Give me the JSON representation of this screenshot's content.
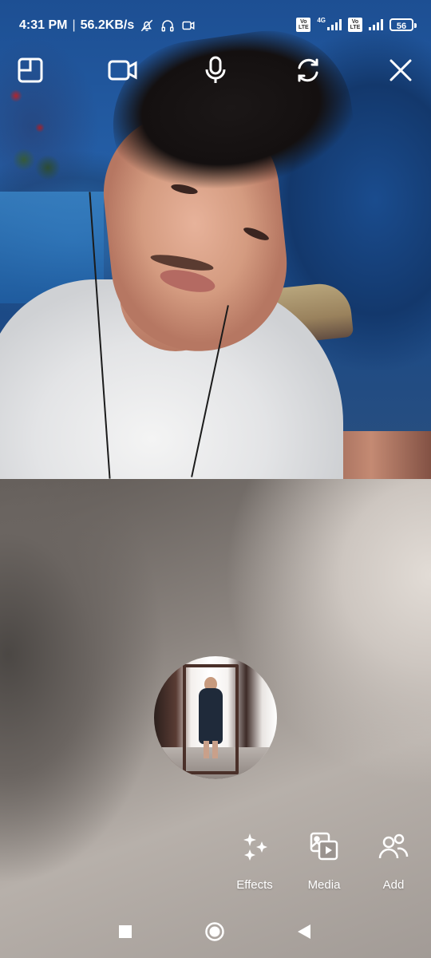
{
  "status_bar": {
    "time": "4:31 PM",
    "separator": "|",
    "speed": "56.2KB/s",
    "icons": [
      "mute-notifications-icon",
      "headphones-icon",
      "video-recording-icon"
    ],
    "network_badges": [
      "Vo LTE",
      "4G",
      "Vo LTE"
    ],
    "battery": "56"
  },
  "call_controls": {
    "layout_icon": "layout-icon",
    "video_icon": "video-camera-icon",
    "mic_icon": "microphone-icon",
    "switch_camera_icon": "switch-camera-icon",
    "close_icon": "close-icon"
  },
  "actions": {
    "effects_label": "Effects",
    "media_label": "Media",
    "add_label": "Add"
  },
  "nav_bar": {
    "recents_icon": "recents-square-icon",
    "home_icon": "home-circle-icon",
    "back_icon": "back-triangle-icon"
  },
  "colors": {
    "icon_white": "#ffffff",
    "feed_blue": "#1f4e88",
    "bottom_gray": "#8a837e"
  }
}
